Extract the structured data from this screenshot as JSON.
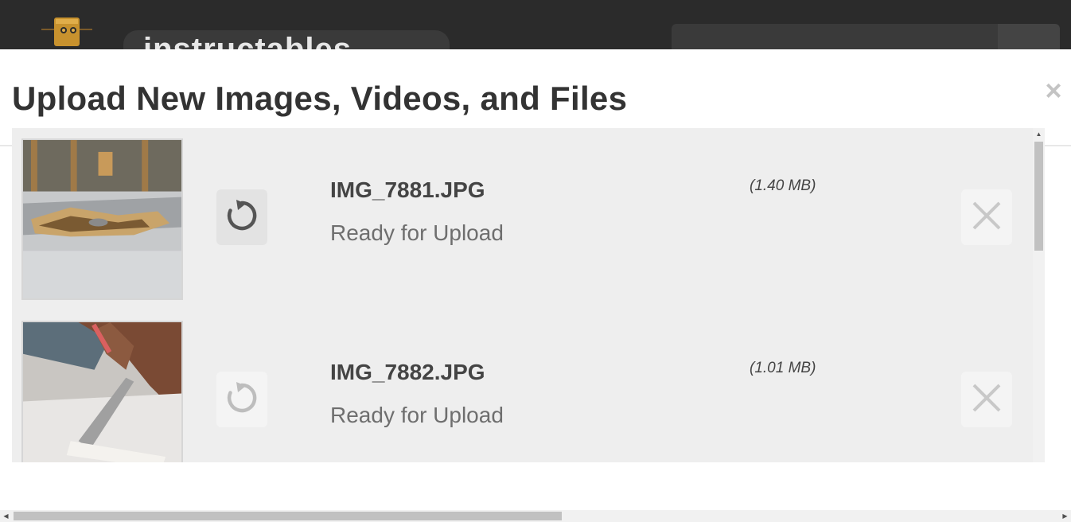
{
  "site_header": {
    "logo_icon": "robot-logo-icon",
    "logo_text": "instructables",
    "search_icon": "search-icon"
  },
  "modal": {
    "title": "Upload New Images, Videos, and Files",
    "close_label": "×",
    "close_icon": "close-icon"
  },
  "files": [
    {
      "name": "IMG_7881.JPG",
      "status": "Ready for Upload",
      "size": "(1.40 MB)",
      "rotate_icon": "rotate-icon",
      "remove_icon": "remove-x-icon"
    },
    {
      "name": "IMG_7882.JPG",
      "status": "Ready for Upload",
      "size": "(1.01 MB)",
      "rotate_icon": "rotate-icon",
      "remove_icon": "remove-x-icon"
    }
  ],
  "colors": {
    "header_bg": "#2b2b2b",
    "panel_bg": "#eeeeee",
    "title_text": "#333333",
    "status_text": "#6e6e6e"
  }
}
